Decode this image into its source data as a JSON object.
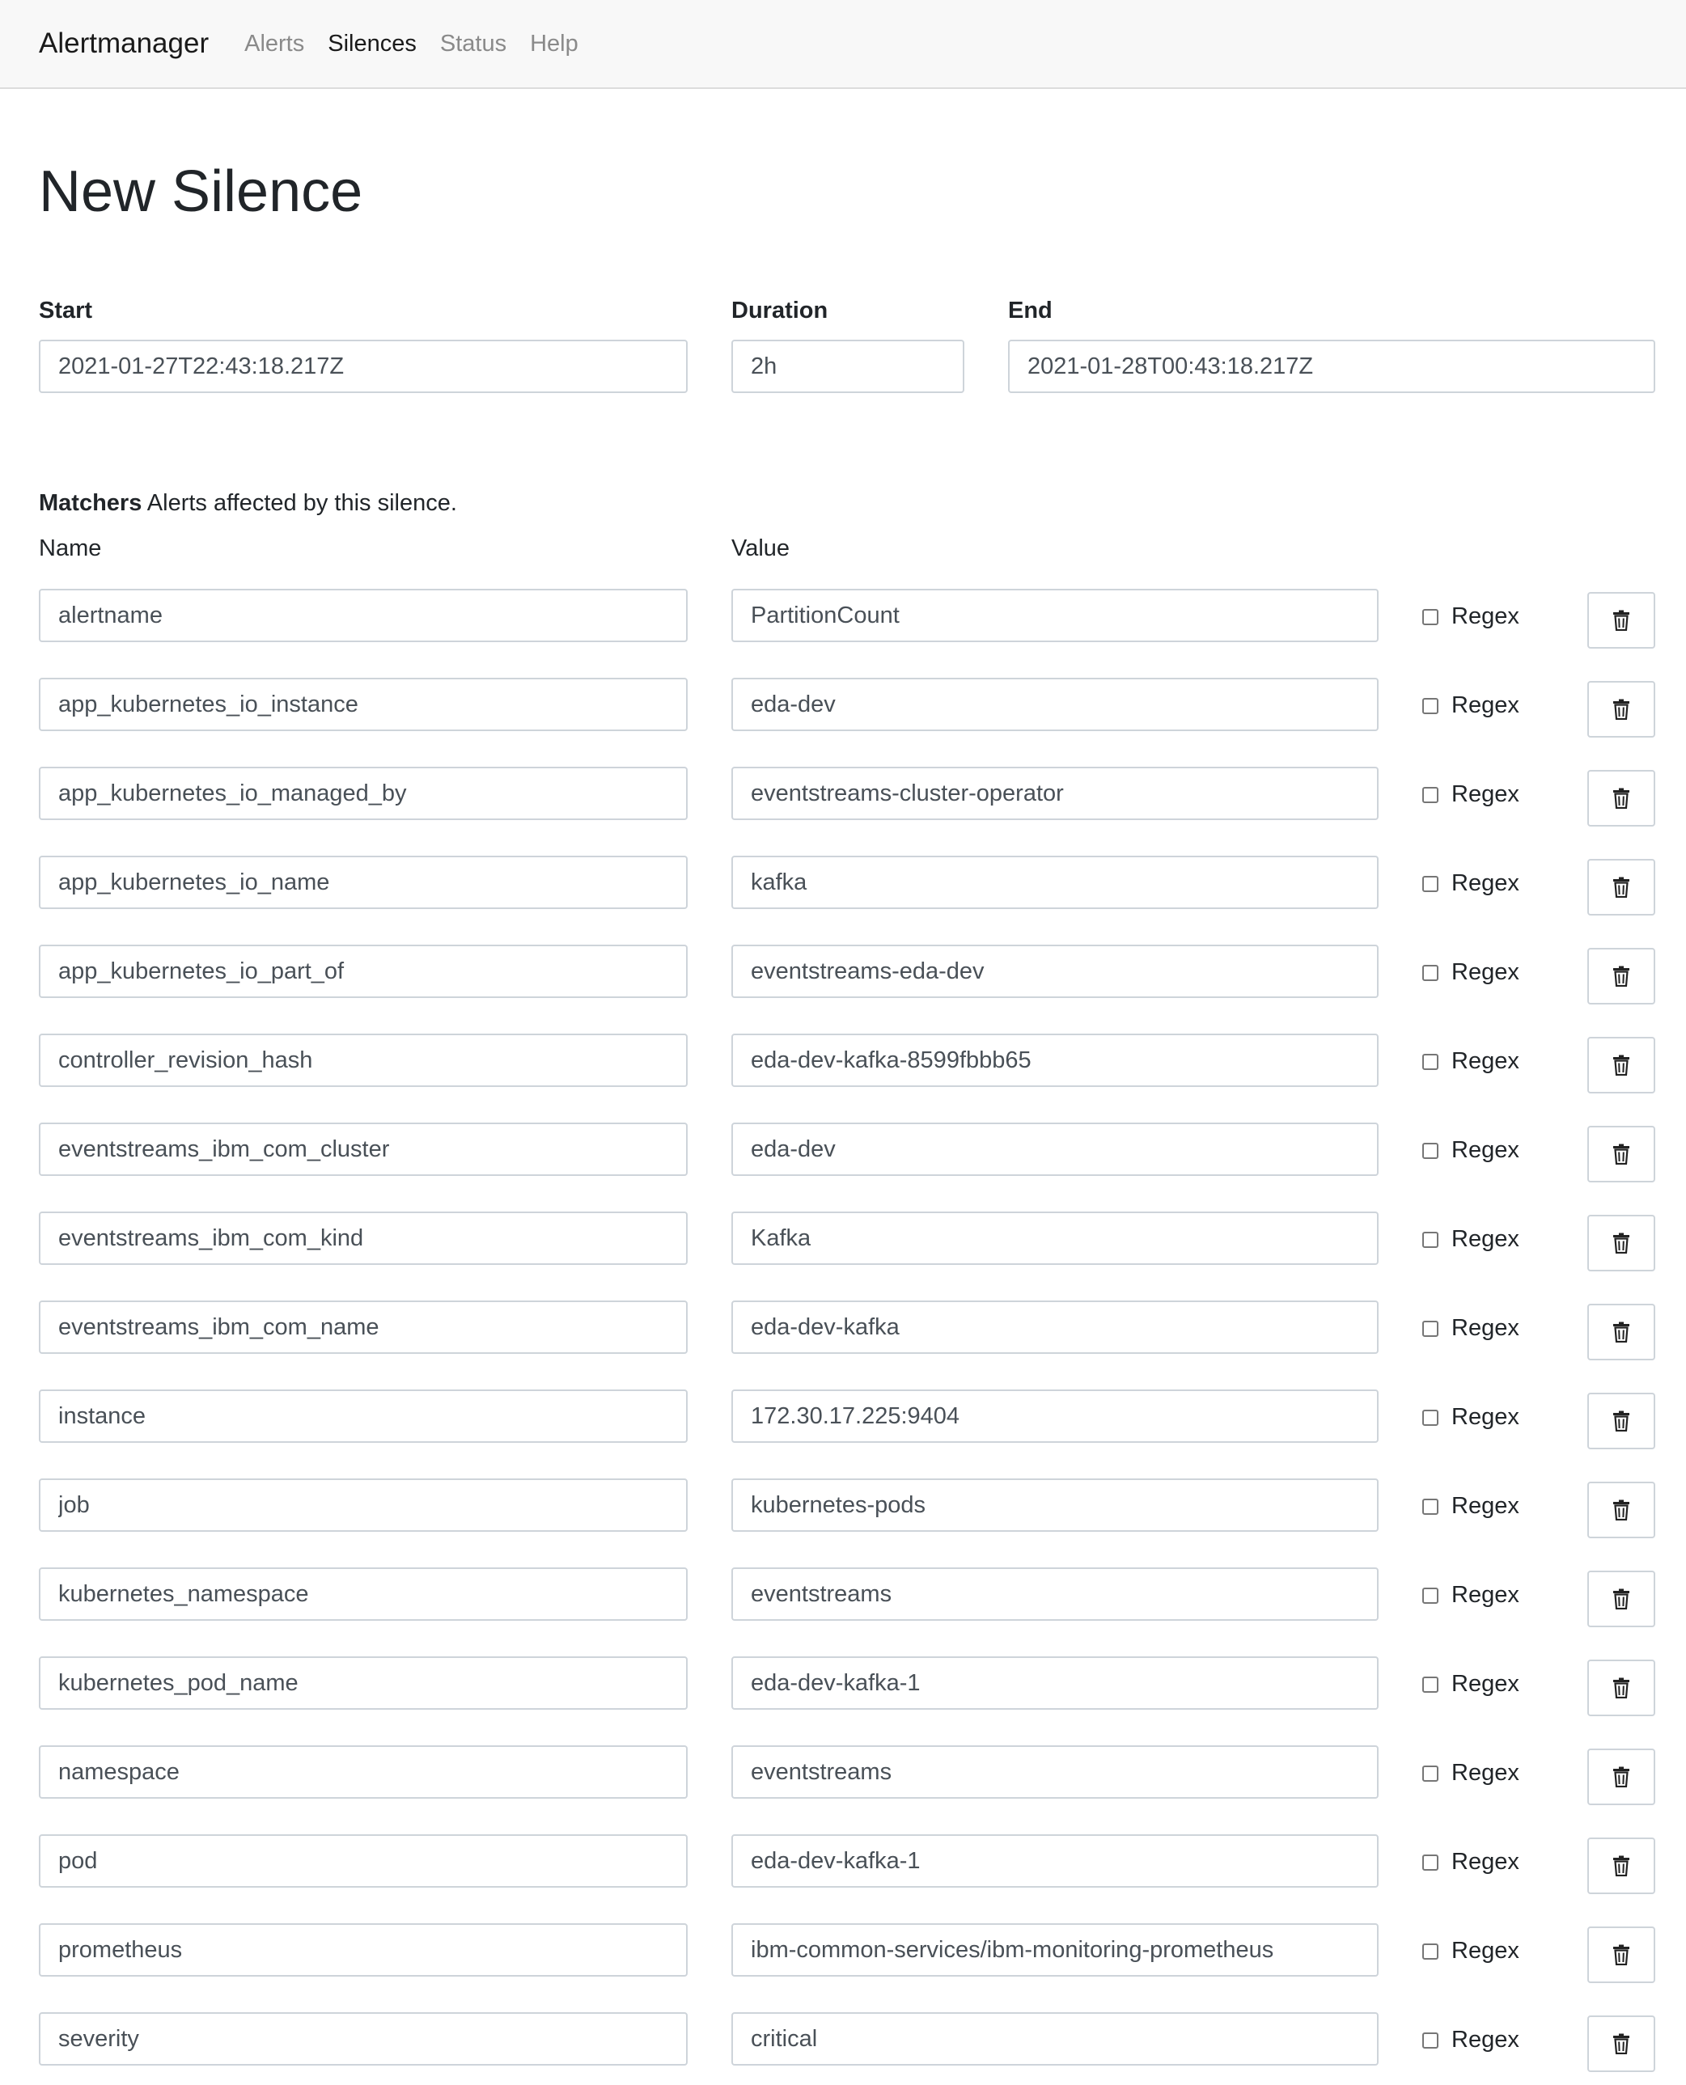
{
  "navbar": {
    "brand": "Alertmanager",
    "links": [
      {
        "label": "Alerts",
        "active": false
      },
      {
        "label": "Silences",
        "active": true
      },
      {
        "label": "Status",
        "active": false
      },
      {
        "label": "Help",
        "active": false
      }
    ]
  },
  "page_title": "New Silence",
  "start": {
    "label": "Start",
    "value": "2021-01-27T22:43:18.217Z"
  },
  "duration": {
    "label": "Duration",
    "value": "2h"
  },
  "end": {
    "label": "End",
    "value": "2021-01-28T00:43:18.217Z"
  },
  "matchers": {
    "title": "Matchers",
    "subtitle": "Alerts affected by this silence.",
    "name_label": "Name",
    "value_label": "Value",
    "regex_label": "Regex",
    "delete_icon": "trash-icon",
    "rows": [
      {
        "name": "alertname",
        "value": "PartitionCount",
        "regex": false
      },
      {
        "name": "app_kubernetes_io_instance",
        "value": "eda-dev",
        "regex": false
      },
      {
        "name": "app_kubernetes_io_managed_by",
        "value": "eventstreams-cluster-operator",
        "regex": false
      },
      {
        "name": "app_kubernetes_io_name",
        "value": "kafka",
        "regex": false
      },
      {
        "name": "app_kubernetes_io_part_of",
        "value": "eventstreams-eda-dev",
        "regex": false
      },
      {
        "name": "controller_revision_hash",
        "value": "eda-dev-kafka-8599fbbb65",
        "regex": false
      },
      {
        "name": "eventstreams_ibm_com_cluster",
        "value": "eda-dev",
        "regex": false
      },
      {
        "name": "eventstreams_ibm_com_kind",
        "value": "Kafka",
        "regex": false
      },
      {
        "name": "eventstreams_ibm_com_name",
        "value": "eda-dev-kafka",
        "regex": false
      },
      {
        "name": "instance",
        "value": "172.30.17.225:9404",
        "regex": false
      },
      {
        "name": "job",
        "value": "kubernetes-pods",
        "regex": false
      },
      {
        "name": "kubernetes_namespace",
        "value": "eventstreams",
        "regex": false
      },
      {
        "name": "kubernetes_pod_name",
        "value": "eda-dev-kafka-1",
        "regex": false
      },
      {
        "name": "namespace",
        "value": "eventstreams",
        "regex": false
      },
      {
        "name": "pod",
        "value": "eda-dev-kafka-1",
        "regex": false
      },
      {
        "name": "prometheus",
        "value": "ibm-common-services/ibm-monitoring-prometheus",
        "regex": false
      },
      {
        "name": "severity",
        "value": "critical",
        "regex": false
      }
    ]
  }
}
